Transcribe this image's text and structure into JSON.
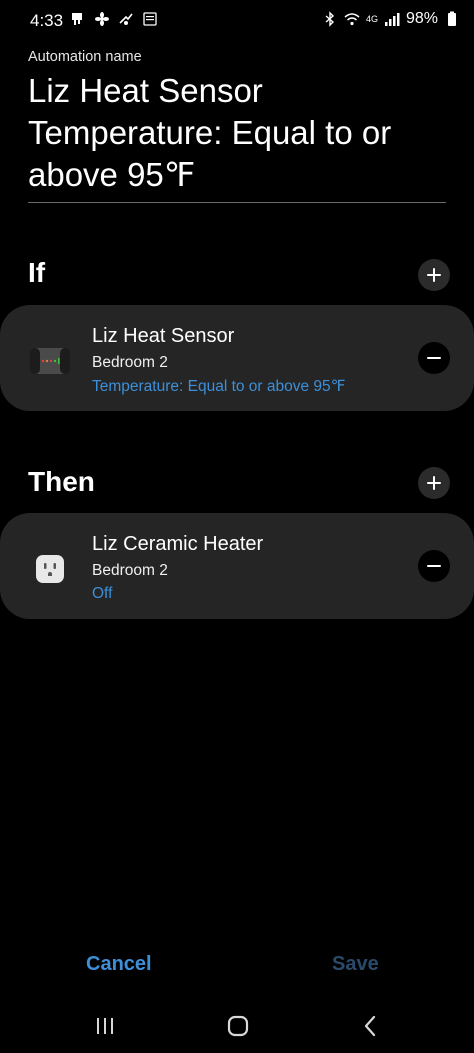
{
  "status_bar": {
    "time": "4:33",
    "network": "4G",
    "battery": "98%"
  },
  "automation": {
    "label": "Automation name",
    "name": "Liz Heat Sensor Temperature: Equal to or above 95℉"
  },
  "if_section": {
    "title": "If",
    "items": [
      {
        "device": "Liz Heat Sensor",
        "room": "Bedroom 2",
        "condition": "Temperature: Equal to or above 95℉",
        "icon": "sensor-icon"
      }
    ]
  },
  "then_section": {
    "title": "Then",
    "items": [
      {
        "device": "Liz Ceramic Heater",
        "room": "Bedroom 2",
        "action": "Off",
        "icon": "plug-icon"
      }
    ]
  },
  "actions": {
    "cancel": "Cancel",
    "save": "Save"
  },
  "colors": {
    "accent": "#3d8fd9",
    "card_bg": "#252525",
    "save_disabled": "#2a4a6b"
  }
}
